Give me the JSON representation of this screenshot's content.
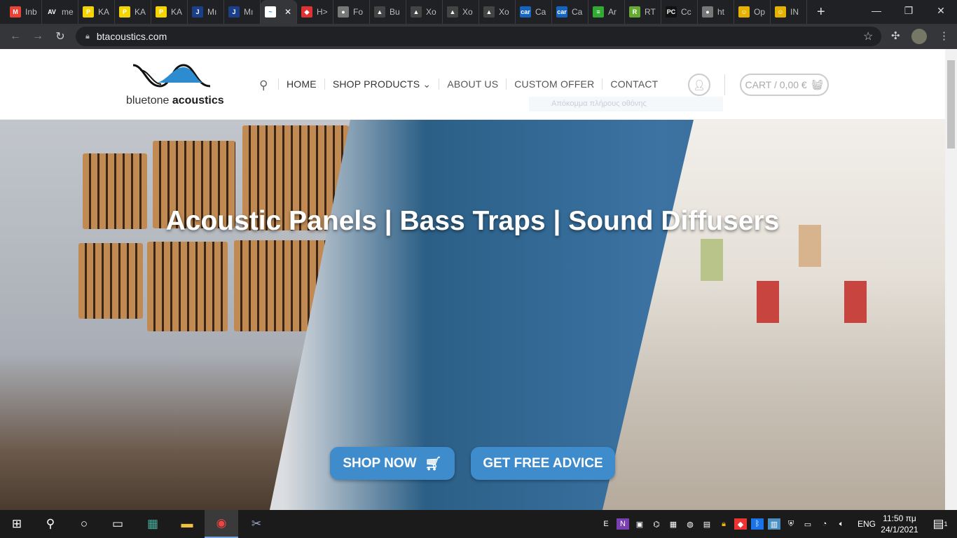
{
  "browser": {
    "tabs": [
      {
        "icon": "gmail-icon",
        "label": "Inb",
        "color": "#ea4335",
        "glyph": "M"
      },
      {
        "icon": "av-icon",
        "label": "me",
        "color": "#202124",
        "glyph": "AV"
      },
      {
        "icon": "p-icon",
        "label": "KA",
        "color": "#f5d400",
        "glyph": "P"
      },
      {
        "icon": "p-icon",
        "label": "KA",
        "color": "#f5d400",
        "glyph": "P"
      },
      {
        "icon": "p-icon",
        "label": "KA",
        "color": "#f5d400",
        "glyph": "P"
      },
      {
        "icon": "jysk-icon",
        "label": "Mı",
        "color": "#1c3f8a",
        "glyph": "J"
      },
      {
        "icon": "jysk-icon",
        "label": "Mı",
        "color": "#1c3f8a",
        "glyph": "J"
      },
      {
        "icon": "bluetone-icon",
        "label": "",
        "color": "#ffffff",
        "glyph": "~",
        "active": true
      },
      {
        "icon": "rainbow-icon",
        "label": "H>",
        "color": "#d33",
        "glyph": "◆"
      },
      {
        "icon": "globe-icon",
        "label": "Fo",
        "color": "#777",
        "glyph": "●"
      },
      {
        "icon": "hat-icon",
        "label": "Bu",
        "color": "#444",
        "glyph": "▲"
      },
      {
        "icon": "hat-icon",
        "label": "Xo",
        "color": "#444",
        "glyph": "▲"
      },
      {
        "icon": "hat-icon",
        "label": "Xo",
        "color": "#444",
        "glyph": "▲"
      },
      {
        "icon": "hat-icon",
        "label": "Xo",
        "color": "#444",
        "glyph": "▲"
      },
      {
        "icon": "car-icon",
        "label": "Ca",
        "color": "#1565c0",
        "glyph": "car"
      },
      {
        "icon": "car-icon",
        "label": "Ca",
        "color": "#1565c0",
        "glyph": "car"
      },
      {
        "icon": "bars-icon",
        "label": "Ar",
        "color": "#3a3",
        "glyph": "≡"
      },
      {
        "icon": "rew-icon",
        "label": "RT",
        "color": "#6a3",
        "glyph": "R"
      },
      {
        "icon": "pc-icon",
        "label": "Cc",
        "color": "#111",
        "glyph": "PC"
      },
      {
        "icon": "globe-icon",
        "label": "ht",
        "color": "#777",
        "glyph": "●"
      },
      {
        "icon": "face-icon",
        "label": "Op",
        "color": "#e6b200",
        "glyph": "☺"
      },
      {
        "icon": "face-icon",
        "label": "IN",
        "color": "#e6b200",
        "glyph": "☺"
      }
    ],
    "url": "btacoustics.com"
  },
  "site": {
    "logo_light": "bluetone",
    "logo_bold": "acoustics",
    "nav": [
      "HOME",
      "SHOP PRODUCTS",
      "ABOUT US",
      "CUSTOM OFFER",
      "CONTACT"
    ],
    "cart": "CART / 0,00 €",
    "tooltip": "Απόκομμα πλήρους οθόνης",
    "hero_title": "Acoustic Panels | Bass Traps | Sound Diffusers",
    "btn_shop": "SHOP NOW",
    "btn_advice": "GET FREE ADVICE"
  },
  "taskbar": {
    "lang": "ENG",
    "time": "11:50 πμ",
    "date": "24/1/2021",
    "notifications": "1"
  }
}
